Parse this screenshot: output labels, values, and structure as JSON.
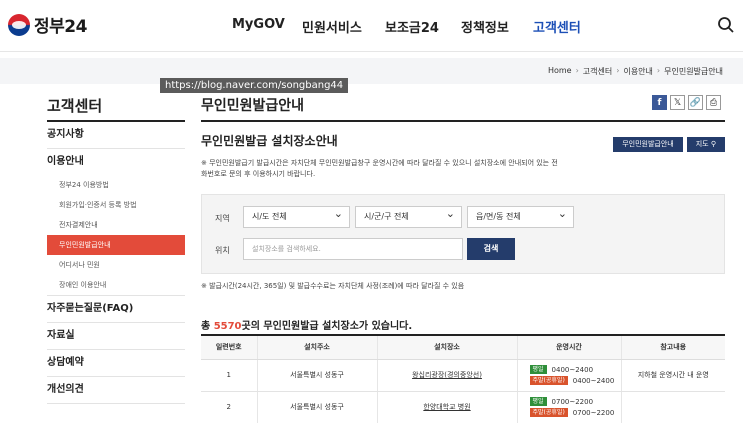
{
  "header": {
    "logo_text": "정부24",
    "nav": [
      "MyGOV",
      "민원서비스",
      "보조금24",
      "정책정보",
      "고객센터"
    ],
    "search_icon": "search-icon"
  },
  "breadcrumb": [
    "Home",
    "고객센터",
    "이용안내",
    "무인민원발급안내"
  ],
  "watermark": "https://blog.naver.com/songbang44",
  "sidebar": {
    "title": "고객센터",
    "items": [
      {
        "label": "공지사항"
      },
      {
        "label": "이용안내",
        "sub": [
          "정부24 이용방법",
          "회원가입·인증서 등록 방법",
          "전자결제안내",
          "무인민원발급안내",
          "어디서나 민원",
          "장애인 이용안내"
        ],
        "active_sub": 3
      },
      {
        "label": "자주묻는질문(FAQ)"
      },
      {
        "label": "자료실"
      },
      {
        "label": "상담예약"
      },
      {
        "label": "개선의견"
      }
    ]
  },
  "main": {
    "page_title": "무인민원발급안내",
    "share_icons": [
      "facebook-icon",
      "x-icon",
      "link-icon",
      "print-icon"
    ],
    "section_title": "무인민원발급 설치장소안내",
    "btn_guide": "무인민원발급안내",
    "btn_map": "지도",
    "notice": "※ 무인민원발급기 발급시간은 자치단체 무인민원발급창구 운영시간에 따라 달라질 수 있으니 설치장소에 안내되어 있는 전화번호로 문의 후 이용하시기 바랍니다.",
    "filter": {
      "region_label": "지역",
      "select1": "시/도 전체",
      "select2": "시/군/구 전체",
      "select3": "읍/면/동 전체",
      "location_label": "위치",
      "input_placeholder": "설치장소를 검색하세요.",
      "search_button": "검색"
    },
    "notice2": "※ 발급시간(24시간, 365일) 및 발급수수료는 자치단체 사정(조례)에 따라 달라질 수 있음",
    "count_prefix": "총 ",
    "count_value": "5570",
    "count_suffix": "곳의 무인민원발급 설치장소가 있습니다.",
    "table": {
      "headers": [
        "일련번호",
        "설치주소",
        "설치장소",
        "운영시간",
        "참고내용"
      ],
      "rows": [
        {
          "no": "1",
          "addr": "서울특별시 성동구",
          "place": "왕십리광장(경의중앙선)",
          "tag1": "평일",
          "time1": "0400~2400",
          "tag2": "주말(공휴일)",
          "time2": "0400~2400",
          "note": "지하철 운영시간 내 운영"
        },
        {
          "no": "2",
          "addr": "서울특별시 성동구",
          "place": "한양대학교 병원",
          "tag1": "평일",
          "time1": "0700~2200",
          "tag2": "주말(공휴일)",
          "time2": "0700~2200",
          "note": ""
        }
      ]
    }
  },
  "colors": {
    "accent": "#1c4fb6",
    "active": "#e34b3a",
    "navy": "#243c6b"
  }
}
